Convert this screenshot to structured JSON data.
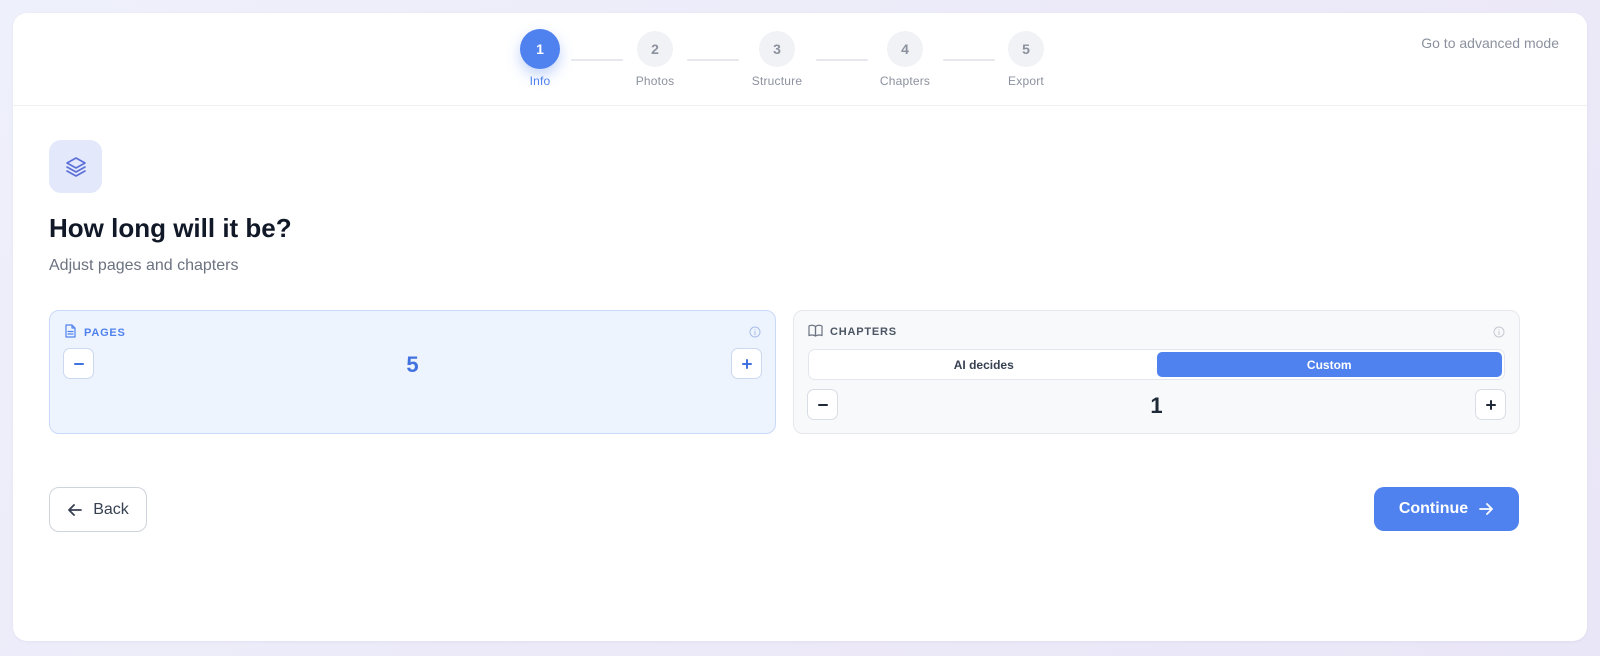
{
  "stepper": {
    "steps": [
      {
        "number": "1",
        "label": "Info",
        "active": true
      },
      {
        "number": "2",
        "label": "Photos",
        "active": false
      },
      {
        "number": "3",
        "label": "Structure",
        "active": false
      },
      {
        "number": "4",
        "label": "Chapters",
        "active": false
      },
      {
        "number": "5",
        "label": "Export",
        "active": false
      }
    ]
  },
  "header": {
    "advanced_mode_link": "Go to advanced mode"
  },
  "main": {
    "icon": "layers-icon",
    "title": "How long will it be?",
    "subtitle": "Adjust pages and chapters"
  },
  "pages_panel": {
    "label": "PAGES",
    "value": "5",
    "decrement": "−",
    "increment": "+"
  },
  "chapters_panel": {
    "label": "CHAPTERS",
    "options": [
      "AI decides",
      "Custom"
    ],
    "selected_option": "Custom",
    "value": "1",
    "decrement": "−",
    "increment": "+"
  },
  "footer": {
    "back_label": "Back",
    "continue_label": "Continue"
  },
  "colors": {
    "accent": "#4f82ee",
    "accent_light": "#eef4fd",
    "text_primary": "#111827",
    "text_muted": "#8b919e"
  }
}
